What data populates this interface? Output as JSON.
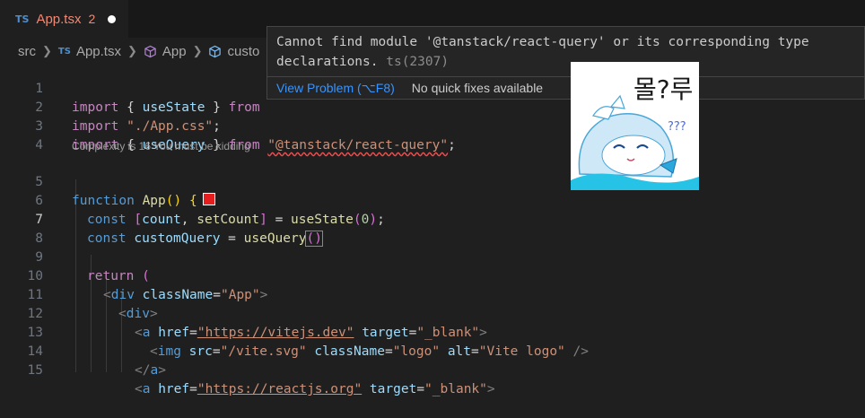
{
  "tab": {
    "lang_badge": "TS",
    "title": "App.tsx",
    "problem_count": "2"
  },
  "breadcrumb": {
    "folder": "src",
    "lang_badge": "TS",
    "file": "App.tsx",
    "component": "App",
    "symbol": "custo"
  },
  "codelens": "Complexity is 16 You must be kidding",
  "line_numbers": [
    "1",
    "2",
    "3",
    "4",
    "5",
    "6",
    "7",
    "8",
    "9",
    "10",
    "11",
    "12",
    "13",
    "14",
    "15"
  ],
  "code": {
    "l1": {
      "import": "import",
      "open": "{",
      "name": "useState",
      "close": "}",
      "from": "from"
    },
    "l2": {
      "import": "import",
      "module": "\"./App.css\"",
      "semi": ";"
    },
    "l3": {
      "import": "import",
      "open": "{",
      "name": "useQuery",
      "close": "}",
      "from": "from",
      "module": "\"@tanstack/react-query\"",
      "semi": ";"
    },
    "l5": {
      "function": "function",
      "name": "App",
      "parens": "()",
      "brace": "{"
    },
    "l6": {
      "const": "const",
      "lb": "[",
      "a": "count",
      "comma": ",",
      "b": "setCount",
      "rb": "]",
      "eq": "=",
      "fn": "useState",
      "lp": "(",
      "num": "0",
      "rp": ")",
      "semi": ";"
    },
    "l7": {
      "const": "const",
      "name": "customQuery",
      "eq": "=",
      "fn": "useQuery",
      "parens": "()"
    },
    "l9": {
      "ret": "return",
      "paren": "("
    },
    "l10": {
      "lt": "<",
      "tag": "div",
      "attr": "className",
      "eq": "=",
      "val": "\"App\"",
      "gt": ">"
    },
    "l11": {
      "lt": "<",
      "tag": "div",
      "gt": ">"
    },
    "l12": {
      "lt": "<",
      "tag": "a",
      "attr1": "href",
      "eq": "=",
      "val1": "\"https://vitejs.dev\"",
      "attr2": "target",
      "val2": "\"_blank\"",
      "gt": ">"
    },
    "l13": {
      "lt": "<",
      "tag": "img",
      "attr1": "src",
      "val1": "\"/vite.svg\"",
      "attr2": "className",
      "val2": "\"logo\"",
      "attr3": "alt",
      "val3": "\"Vite logo\"",
      "close": "/>"
    },
    "l14": {
      "close": "</",
      "tag": "a",
      "gt": ">"
    },
    "l15": {
      "lt": "<",
      "tag": "a",
      "attr1": "href",
      "eq": "=",
      "val1": "\"https://reactjs.org\"",
      "attr2": "target",
      "val2": "\"_blank\"",
      "gt": ">"
    }
  },
  "hover": {
    "message": "Cannot find module '@tanstack/react-query' or its corresponding type declarations.",
    "code": "ts(2307)",
    "view_problem": "View Problem (⌥F8)",
    "no_quick_fixes": "No quick fixes available"
  },
  "sticker": {
    "text": "몰?루",
    "question_marks": "???"
  },
  "colors": {
    "error": "#f14c4c",
    "accent_link": "#3794ff",
    "tab_modified": "#f48771",
    "color_swatch": "#e51f1f"
  }
}
